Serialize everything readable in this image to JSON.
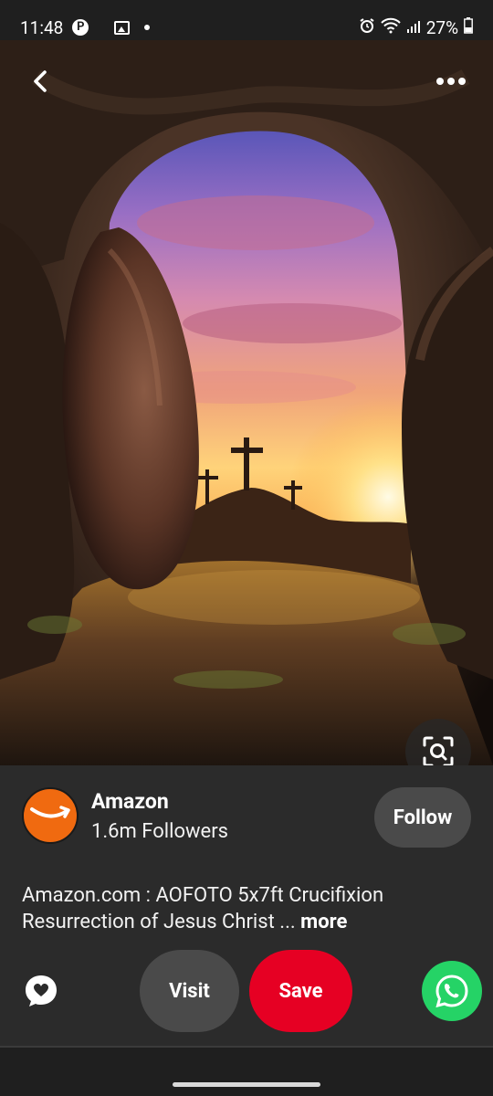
{
  "status_bar": {
    "time": "11:48",
    "pin_glyph": "P",
    "battery": "27%",
    "icons": [
      "pinterest-icon",
      "image-icon",
      "alarm-icon",
      "wifi-icon",
      "signal-icon",
      "battery-icon"
    ]
  },
  "pin_image": {
    "icons": [
      "back-arrow-icon",
      "more-options-icon",
      "visual-search-icon"
    ]
  },
  "creator": {
    "name": "Amazon",
    "followers": "1.6m Followers",
    "follow_label": "Follow",
    "avatar_color": "#f06a10"
  },
  "description": {
    "text": "Amazon.com : AOFOTO 5x7ft Crucifixion Resurrection of Jesus Christ ... ",
    "more_label": "more"
  },
  "actions": {
    "visit_label": "Visit",
    "save_label": "Save",
    "save_color": "#e60023",
    "share_color": "#25d366",
    "icons": [
      "comment-icon",
      "whatsapp-icon"
    ]
  }
}
